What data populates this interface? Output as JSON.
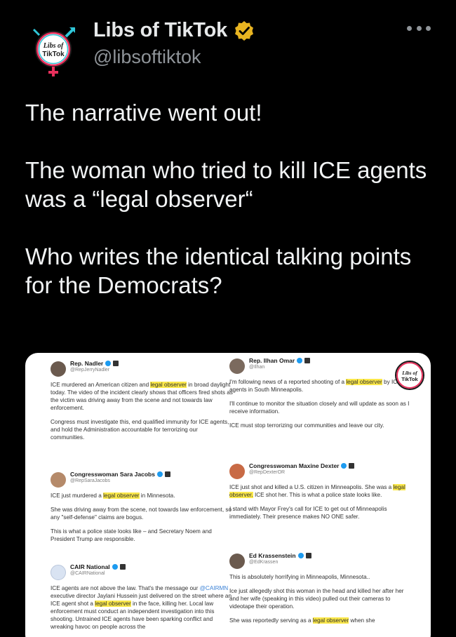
{
  "author": {
    "name": "Libs of TikTok",
    "handle": "@libsoftiktok",
    "avatar_icon": "libs-of-tiktok-logo",
    "verified_icon": "gold-verified-badge-icon",
    "verified_color": "#e8b421"
  },
  "menu": {
    "icon": "more-options-icon"
  },
  "post": {
    "line1": "The narrative went out!",
    "line2": "The woman who tried to kill ICE agents was a “legal observer“",
    "line3": "Who writes the identical talking points for the Democrats?"
  },
  "embed": {
    "left": [
      {
        "name": "Rep. Nadler",
        "handle": "@RepJerryNadler",
        "body": [
          [
            "ICE murdered an American citizen and ",
            {
              "hl": "legal observer"
            },
            " in broad daylight today. The video of the incident clearly shows that officers fired shots as the victim was driving away from the scene and not towards law enforcement."
          ],
          [
            "Congress must investigate this, end qualified immunity for ICE agents, and hold the Administration accountable for terrorizing our communities."
          ]
        ]
      },
      {
        "name": "Congresswoman Sara Jacobs",
        "handle": "@RepSaraJacobs",
        "body": [
          [
            "ICE just murdered a ",
            {
              "hl": "legal observer"
            },
            " in Minnesota."
          ],
          [
            "She was driving away from the scene, not towards law enforcement, so any \"self-defense\" claims are bogus."
          ],
          [
            "This is what a police state looks like – and Secretary Noem and President Trump are responsible."
          ]
        ]
      },
      {
        "name": "CAIR National",
        "handle": "@CAIRNational",
        "body": [
          [
            "ICE agents are not above the law. That's the message our ",
            {
              "link": "@CAIRMN"
            },
            " executive director Jaylani Hussein just delivered on the street where an ICE agent shot a ",
            {
              "hl": "legal observer"
            },
            " in the face, killing her. Local law enforcement must conduct an independent investigation into this shooting. Untrained ICE agents have been sparking conflict and wreaking havoc on people across the"
          ]
        ]
      }
    ],
    "right": [
      {
        "name": "Rep. Ilhan Omar",
        "handle": "@Ilhan",
        "body": [
          [
            "I'm following news of a reported shooting of a ",
            {
              "hl": "legal observer"
            },
            " by ICE agents in South Minneapolis."
          ],
          [
            "I'll continue to monitor the situation closely and will update as soon as I receive information."
          ],
          [
            "ICE must stop terrorizing our communities and leave our city."
          ]
        ]
      },
      {
        "name": "Congresswoman Maxine Dexter",
        "handle": "@RepDexterOR",
        "body": [
          [
            "ICE just shot and killed a U.S. citizen in Minneapolis. She was a ",
            {
              "hl": "legal observer."
            },
            " ICE shot her. This is what a police state looks like."
          ],
          [
            "I stand with Mayor Frey's call for ICE to get out of Minneapolis immediately. Their presence makes NO ONE safer."
          ]
        ]
      },
      {
        "name": "Ed Krassenstein",
        "handle": "@EdKrassen",
        "body": [
          [
            "This is absolutely horrifying in Minneapolis, Minnesota.."
          ],
          [
            "Ice just allegedly shot this woman in the head and killed her after her and her wife (speaking in this video) pulled out their cameras to videotape their operation."
          ],
          [
            "She was reportedly serving as a ",
            {
              "hl": "legal observer"
            },
            " when she"
          ]
        ]
      }
    ],
    "watermark_text": "Libs of TikTok"
  }
}
